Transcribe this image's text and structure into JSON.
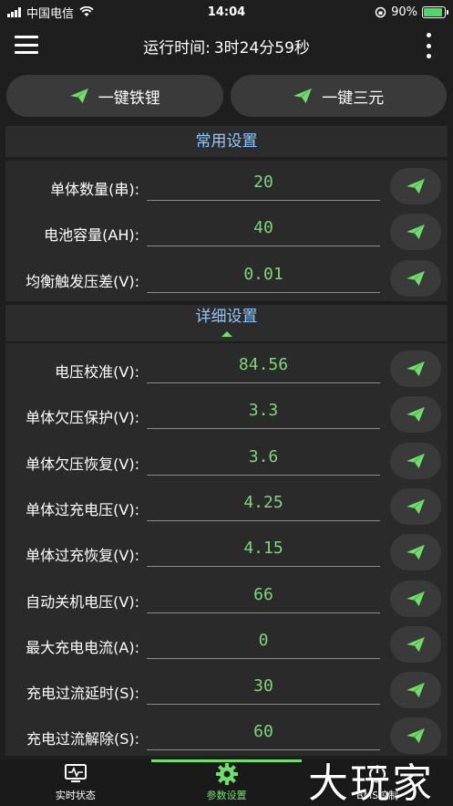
{
  "status_bar": {
    "carrier": "中国电信",
    "time": "14:04",
    "battery_percent": "90%",
    "battery_level": 0.9
  },
  "header": {
    "title_label": "运行时间:",
    "title_value": "3时24分59秒"
  },
  "quick_buttons": [
    {
      "label": "一键铁锂",
      "icon": "send-icon"
    },
    {
      "label": "一键三元",
      "icon": "send-icon"
    }
  ],
  "sections": {
    "common": "常用设置",
    "detail": "详细设置"
  },
  "common_rows": [
    {
      "label": "单体数量(串):",
      "value": "20"
    },
    {
      "label": "电池容量(AH):",
      "value": "40"
    },
    {
      "label": "均衡触发压差(V):",
      "value": "0.01"
    }
  ],
  "detail_rows": [
    {
      "label": "电压校准(V):",
      "value": "84.56"
    },
    {
      "label": "单体欠压保护(V):",
      "value": "3.3"
    },
    {
      "label": "单体欠压恢复(V):",
      "value": "3.6"
    },
    {
      "label": "单体过充电压(V):",
      "value": "4.25"
    },
    {
      "label": "单体过充恢复(V):",
      "value": "4.15"
    },
    {
      "label": "自动关机电压(V):",
      "value": "66"
    },
    {
      "label": "最大充电电流(A):",
      "value": "0"
    },
    {
      "label": "充电过流延时(S):",
      "value": "30"
    },
    {
      "label": "充电过流解除(S):",
      "value": "60"
    }
  ],
  "bottom_nav": [
    {
      "label": "实时状态",
      "icon": "monitor-icon",
      "active": false
    },
    {
      "label": "参数设置",
      "icon": "gear-icon",
      "active": true
    },
    {
      "label": "BMS控制",
      "icon": "power-icon",
      "active": false
    }
  ],
  "watermark": "大玩家",
  "colors": {
    "accent_green": "#6ee06a",
    "value_green": "#7ed67a",
    "section_blue": "#8fc7ff",
    "background": "#1e1e1e"
  }
}
